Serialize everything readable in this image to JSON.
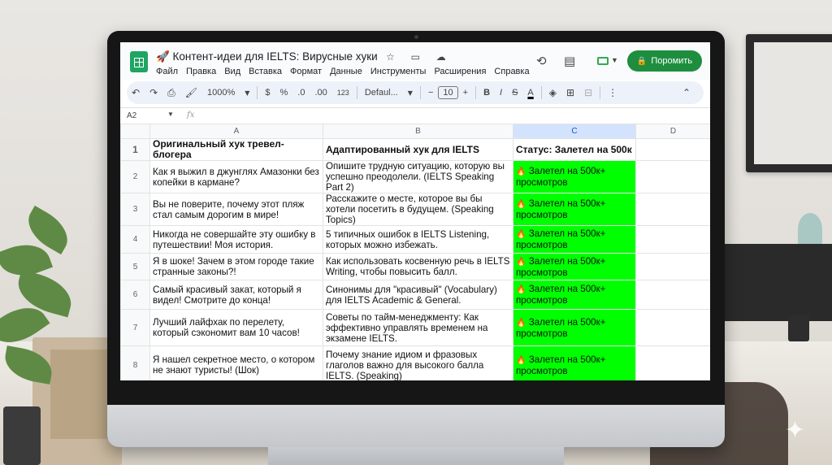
{
  "doc": {
    "title": "🚀 Контент-идеи для IELTS: Вирусные хуки",
    "title_icons": "☆ ▭ ☁"
  },
  "menu": [
    "Файл",
    "Правка",
    "Вид",
    "Вставка",
    "Формат",
    "Данные",
    "Инструменты",
    "Расширения",
    "Справка"
  ],
  "share_label": "Поромить",
  "toolbar": {
    "undo": "↶",
    "redo": "↷",
    "print": "⎙",
    "paint_format": "🖌",
    "zoom": "1000%",
    "currency": "$",
    "percent": "%",
    "dec_decrease": ".0",
    "dec_increase": ".00",
    "number_format": "123",
    "font": "Defaul...",
    "font_minus": "−",
    "font_size": "10",
    "font_plus": "+",
    "bold": "B",
    "italic": "I",
    "strike": "S",
    "text_color": "A",
    "fill": "◈",
    "borders": "⊞",
    "merge": "⊟",
    "more": "⋮",
    "collapse": "⌃"
  },
  "formula": {
    "cell_ref": "A2",
    "fx": "fx"
  },
  "columns": [
    "A",
    "B",
    "C",
    "D"
  ],
  "header_row": {
    "num": "1",
    "a": "Оригинальный хук тревел-блогера",
    "b": "Адаптированный хук для IELTS",
    "c": "Статус: Залетел на 500к"
  },
  "rows": [
    {
      "num": "2",
      "a": "Как я выжил в джунглях Амазонки без копейки в кармане?",
      "b": "Опишите трудную ситуацию, которую вы успешно преодолели. (IELTS Speaking Part 2)",
      "c": "Залетел на 500к+ просмотров"
    },
    {
      "num": "3",
      "a": "Вы не поверите, почему этот пляж стал самым дорогим в мире!",
      "b": "Расскажите о месте, которое вы бы хотели посетить в будущем. (Speaking Topics)",
      "c": "Залетел на 500к+ просмотров"
    },
    {
      "num": "4",
      "a": "Никогда не совершайте эту ошибку в путешествии! Моя история.",
      "b": "5 типичных ошибок в IELTS Listening, которых можно избежать.",
      "c": "Залетел на 500к+ просмотров"
    },
    {
      "num": "5",
      "a": "Я в шоке! Зачем в этом городе такие странные законы?!",
      "b": "Как использовать косвенную речь в IELTS Writing, чтобы повысить балл.",
      "c": "Залетел на 500к+ просмотров"
    },
    {
      "num": "6",
      "a": "Самый красивый закат, который я видел! Смотрите до конца!",
      "b": "Синонимы для \"красивый\" (Vocabulary) для IELTS Academic & General.",
      "c": "Залетел на 500к+ просмотров"
    },
    {
      "num": "7",
      "a": "Лучший лайфхак по перелету, который сэкономит вам 10 часов!",
      "b": "Советы по тайм-менеджменту: Как эффективно управлять временем на экзамене IELTS.",
      "c": "Залетел на 500к+ просмотров"
    },
    {
      "num": "8",
      "a": "Я нашел секретное место, о котором не знают туристы! (Шок)",
      "b": "Почему знание идиом и фразовых глаголов важно для высокого балла IELTS. (Speaking)",
      "c": "Залетел на 500к+ просмотров"
    }
  ],
  "colors": {
    "status_fill": "#00ff00",
    "share_button": "#1e8e3e",
    "sheets_green": "#1fa463"
  }
}
